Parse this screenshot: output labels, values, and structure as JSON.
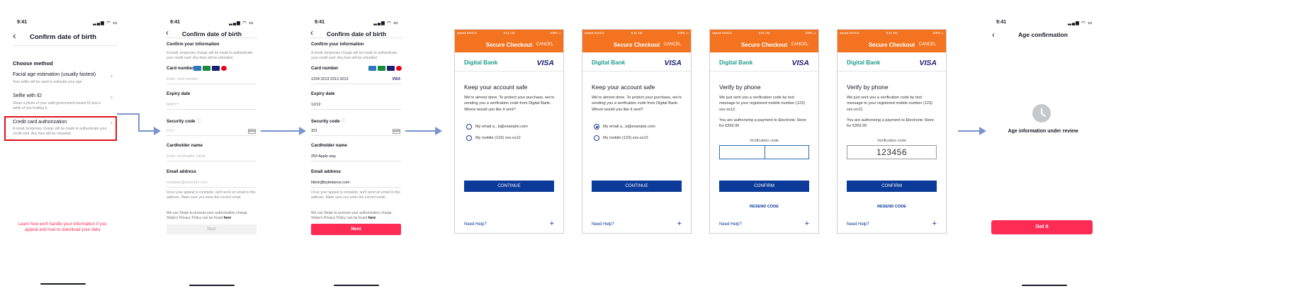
{
  "status_time": "9:41",
  "status_icons": "▂▄▆ ◠ ▭",
  "back_glyph": "‹",
  "screen1": {
    "title": "Confirm date of birth",
    "section": "Choose method",
    "options": [
      {
        "title": "Facial age estimation (usually fastest)",
        "desc": "Your selfie will be used to estimate your age."
      },
      {
        "title": "Selfie with ID",
        "desc": "Share a photo of your valid government-issued ID and a selfie of you holding it."
      },
      {
        "title": "Credit card authorization",
        "desc": "A small, temporary charge will be made to authenticate your credit card. Any fees will be refunded."
      }
    ],
    "footer_link": "Learn how we'll handle your information if you appeal and how to download your data",
    "highlight_color": "#e0141e"
  },
  "card_form": {
    "title": "Confirm date of birth",
    "heading": "Confirm your information",
    "intro": "A small, temporary charge will be made to authenticate your credit card. Any fees will be refunded.",
    "card_label": "Card number",
    "card_logos": [
      "AMEX",
      "JCB",
      "VISA",
      "MC"
    ],
    "expiry_label": "Expiry date",
    "security_label": "Security code",
    "security_info": "ⓘ",
    "holder_label": "Cardholder name",
    "email_label": "Email address",
    "email_note": "Once your appeal is complete, we'll send an email to this address. Make sure you enter the correct email.",
    "stripe_note": "We use Stripe to process your authorization charge. Stripe's Privacy Policy can be found ",
    "stripe_link": "here",
    "next_label": "Next"
  },
  "screen2": {
    "card_placeholder": "Enter card number",
    "expiry_placeholder": "MM/YY",
    "cvv_placeholder": "CVV",
    "holder_placeholder": "Enter cardholder name",
    "email_placeholder": "example@example.com"
  },
  "screen3": {
    "card_value": "1234 3213 2313 3213",
    "card_brand": "VISA",
    "expiry_value": "12/12",
    "cvv_value": "321",
    "holder_value": "250 Apple way",
    "email_value": "tiktok@bytedance.com"
  },
  "checkout": {
    "carrier": "●●●●● Service ",
    "time": "9:41 AM",
    "battery": "100% ▭",
    "title": "Secure Checkout",
    "cancel": "CANCEL",
    "bank": "Digital Bank",
    "visa": "VISA",
    "plus": "+",
    "safe_heading": "Keep your account safe",
    "safe_text": "We're almost done. To protect your purchase, we're sending you a verification code from Digital Bank. Where would you like it sent?",
    "option_email": "My email a...b@example.com",
    "option_mobile": "My mobile (123) xxx-xx12",
    "continue": "CONTINUE",
    "help": "Need Help?",
    "verify_heading": "Verify by phone",
    "verify_text1": "We just sent you a verification code by text message to your registered mobile number (123) xxx-xx12.",
    "verify_text2": "You are authorizing a payment to Electronic Store for €259.95",
    "code_label": "Verification code",
    "code_value": "123456",
    "confirm": "CONFIRM",
    "resend": "RESEND CODE",
    "header_color": "#f37321",
    "button_color": "#0b3a99"
  },
  "final": {
    "title": "Age confirmation",
    "clock_icon": "clock",
    "message": "Age information under review",
    "button": "Got it",
    "button_color": "#fe2c55"
  }
}
